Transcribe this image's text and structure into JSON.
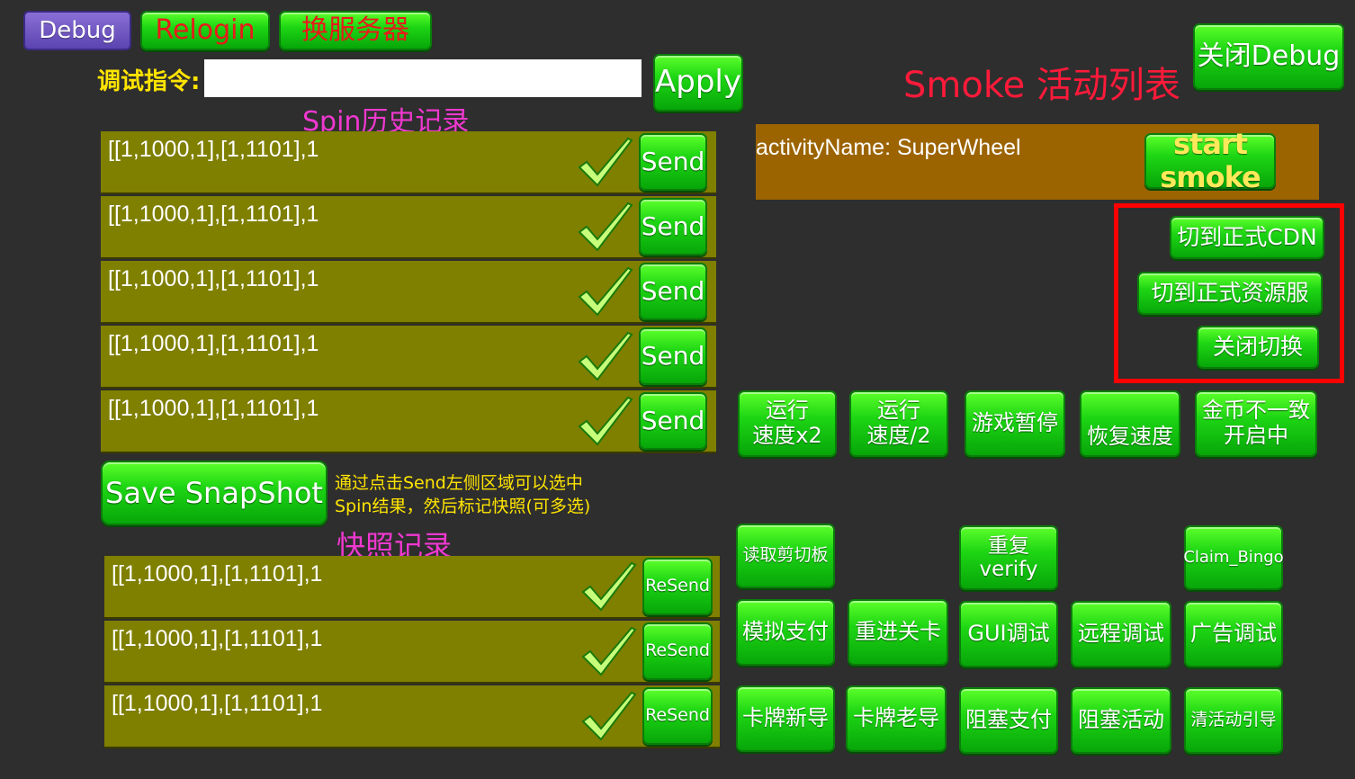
{
  "top_buttons": {
    "debug": "Debug",
    "relogin": "Relogin",
    "switch_server": "换服务器"
  },
  "command": {
    "label": "调试指令:",
    "value": "",
    "apply": "Apply"
  },
  "spin_history": {
    "title": "Spin历史记录",
    "rows": [
      {
        "text": "[[1,1000,1],[1,1101],1",
        "button": "Send"
      },
      {
        "text": "[[1,1000,1],[1,1101],1",
        "button": "Send"
      },
      {
        "text": "[[1,1000,1],[1,1101],1",
        "button": "Send"
      },
      {
        "text": "[[1,1000,1],[1,1101],1",
        "button": "Send"
      },
      {
        "text": "[[1,1000,1],[1,1101],1",
        "button": "Send"
      }
    ]
  },
  "snapshot": {
    "save_button": "Save SnapShot",
    "hint_line1": "通过点击Send左侧区域可以选中",
    "hint_line2": "Spin结果，然后标记快照(可多选)",
    "title": "快照记录",
    "rows": [
      {
        "text": "[[1,1000,1],[1,1101],1",
        "button": "ReSend"
      },
      {
        "text": "[[1,1000,1],[1,1101],1",
        "button": "ReSend"
      },
      {
        "text": "[[1,1000,1],[1,1101],1",
        "button": "ReSend"
      }
    ]
  },
  "smoke": {
    "title": "Smoke 活动列表",
    "close_debug": "关闭Debug",
    "activity_label": "activityName: SuperWheel",
    "start_button": "start smoke"
  },
  "cdn_panel": {
    "to_cdn": "切到正式CDN",
    "to_resource": "切到正式资源服",
    "close_switch": "关闭切换",
    "border_color": "#ff0000"
  },
  "speed_row": {
    "speed_x2": "运行\n速度x2",
    "speed_half": "运行\n速度/2",
    "pause": "游戏暂停",
    "restore": "恢复速度",
    "coin_mismatch": "金币不一致\n开启中"
  },
  "tools": {
    "read_clipboard": "读取剪切板",
    "repeat_verify": "重复verify",
    "claim_bingo": "Claim_Bingo",
    "mock_pay": "模拟支付",
    "reenter_level": "重进关卡",
    "gui_debug": "GUI调试",
    "remote_debug": "远程调试",
    "ad_debug": "广告调试",
    "card_new_guide": "卡牌新导",
    "card_old_guide": "卡牌老导",
    "block_pay": "阻塞支付",
    "block_activity": "阻塞活动",
    "clear_activity_guide": "清活动引导"
  },
  "colors": {
    "background": "#2e2e2e",
    "row_olive": "#7f7f00",
    "activity_bg": "#9c6400",
    "button_green": "#1ed614",
    "title_pink": "#f038d0",
    "label_yellow": "#ffe400",
    "smoke_title_red": "#ff1a3a"
  }
}
